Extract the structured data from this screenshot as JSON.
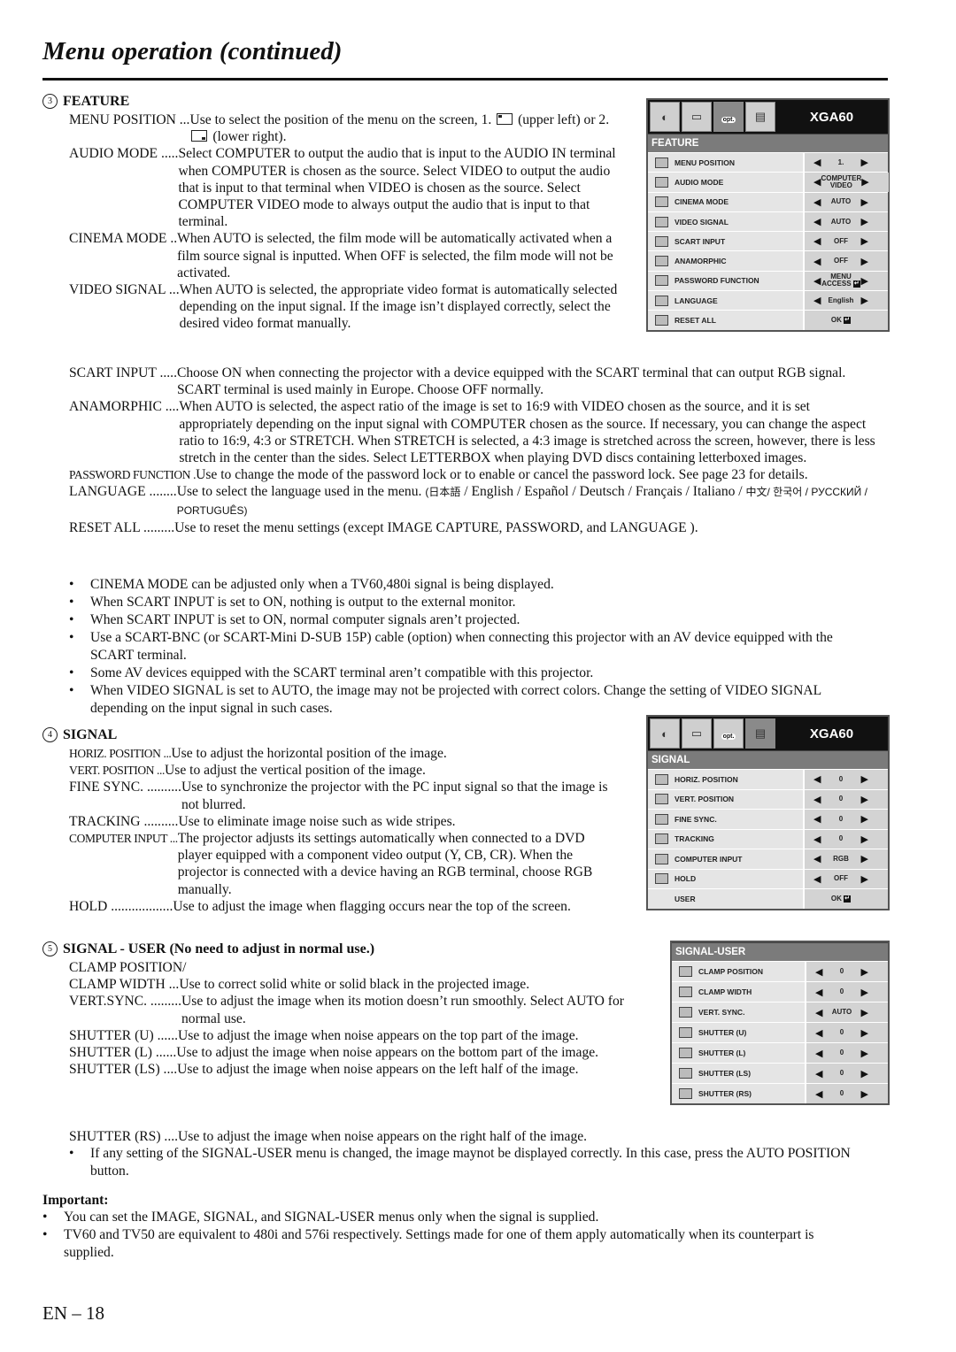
{
  "page": {
    "title": "Menu operation (continued)",
    "page_number": "EN – 18"
  },
  "feature": {
    "number": "3",
    "heading": "FEATURE",
    "items": [
      {
        "term": "MENU POSITION ... ",
        "desc_a": "Use to select the position of the menu on the screen,  1. ",
        "desc_b": " (upper left) or 2. ",
        "desc_c": " (lower right)."
      },
      {
        "term": "AUDIO MODE ..... ",
        "desc": "Select COMPUTER to output the audio that is input to the AUDIO IN terminal when COMPUTER is chosen as the source. Select VIDEO to output the audio that is input to that terminal when VIDEO is chosen as the source. Select COMPUTER VIDEO mode to always output the audio that is input to that terminal."
      },
      {
        "term": "CINEMA MODE .. ",
        "desc": "When AUTO is selected, the film mode will be automatically activated when a film source signal is inputted. When OFF is selected, the film mode will not be activated."
      },
      {
        "term": "VIDEO SIGNAL ... ",
        "desc": "When AUTO is selected, the appropriate video format is automatically selected depending on the input signal. If the image isn’t displayed correctly, select the desired video format manually."
      },
      {
        "term": "SCART INPUT ..... ",
        "desc": "Choose ON when connecting the projector with a device equipped with the SCART terminal that can output RGB signal. SCART terminal is used mainly in Europe. Choose OFF normally."
      },
      {
        "term": "ANAMORPHIC .... ",
        "desc": "When AUTO is selected, the aspect ratio of the image is set to 16:9 with VIDEO chosen as the source, and it is set appropriately depending on the input signal with COMPUTER chosen as the source. If necessary, you can change the aspect ratio to 16:9, 4:3 or STRETCH. When STRETCH is selected, a 4:3 image is stretched across the screen, however, there is less stretch in the center than the sides. Select LETTERBOX when playing DVD discs containing letterboxed images."
      },
      {
        "term": "PASSWORD FUNCTION . ",
        "desc": "Use to change the mode of the password lock or to enable or cancel the password lock. See page 23 for details."
      },
      {
        "term": "LANGUAGE ........ ",
        "desc_a": "Use to select the language used in the menu. ",
        "langs_a": "(日本語",
        "desc_b": " / English / Español / Deutsch / Français / Italiano / ",
        "langs_b": "中文/ 한국어 / РУССКИЙ / PORTUGUÊS)"
      },
      {
        "term": "RESET ALL ......... ",
        "desc": "Use to reset the menu settings (except IMAGE CAPTURE, PASSWORD, and LANGUAGE )."
      }
    ],
    "notes": [
      "CINEMA MODE can be adjusted only when a TV60,480i signal is being displayed.",
      "When SCART INPUT is set to ON, nothing is output to the external monitor.",
      "When SCART INPUT is set to ON, normal computer signals aren’t projected.",
      "Use a SCART-BNC (or SCART-Mini D-SUB 15P) cable (option) when connecting this projector with an AV device equipped with the SCART terminal.",
      "Some AV devices equipped with the SCART terminal aren’t compatible with this projector.",
      "When VIDEO SIGNAL is set to AUTO, the image may not be projected with correct colors. Change the setting of VIDEO SIGNAL depending on the input signal in such cases."
    ]
  },
  "signal": {
    "number": "4",
    "heading": "SIGNAL",
    "items": [
      {
        "term": "HORIZ. POSITION ... ",
        "desc": "Use to adjust the horizontal position of the image."
      },
      {
        "term": "VERT. POSITION ... ",
        "desc": "Use to adjust the vertical position of the image."
      },
      {
        "term": "FINE SYNC. .......... ",
        "desc": "Use to synchronize the projector with the PC input signal so that the image is not blurred."
      },
      {
        "term": "TRACKING .......... ",
        "desc": "Use to eliminate image noise such as wide stripes."
      },
      {
        "term": "COMPUTER INPUT ... ",
        "desc": "The projector adjusts its settings automatically when connected to a DVD player equipped with a component video output (Y, CB, CR). When the projector is connected with a device having an RGB terminal, choose RGB manually."
      },
      {
        "term": "HOLD .................. ",
        "desc": "Use to adjust the image when flagging occurs near the top of the screen."
      }
    ]
  },
  "signal_user": {
    "number": "5",
    "heading": "SIGNAL - USER (No need to adjust in normal use.)",
    "items": [
      {
        "term": "CLAMP POSITION/",
        "desc": ""
      },
      {
        "term": "CLAMP WIDTH ... ",
        "desc": "Use to correct solid white or solid black in the projected image."
      },
      {
        "term": "VERT.SYNC. ......... ",
        "desc": "Use to adjust the image when its motion doesn’t run smoothly. Select AUTO for normal use."
      },
      {
        "term": "SHUTTER (U) ...... ",
        "desc": "Use to adjust the image when noise appears on the top part of the image."
      },
      {
        "term": "SHUTTER (L) ...... ",
        "desc": "Use to adjust the image when noise appears on the bottom part of the image."
      },
      {
        "term": "SHUTTER (LS) .... ",
        "desc": "Use to adjust the image when noise appears on the left half of the image."
      },
      {
        "term": "SHUTTER (RS) .... ",
        "desc": "Use to adjust the image when noise appears on the right half of the image."
      }
    ],
    "notes": [
      "If any setting of the SIGNAL-USER menu is changed, the image maynot be displayed correctly. In this case, press the AUTO POSITION button."
    ]
  },
  "important": {
    "heading": "Important:",
    "notes": [
      "You can set the IMAGE, SIGNAL, and SIGNAL-USER menus only when the signal is supplied.",
      "TV60 and TV50 are equivalent to 480i and 576i respectively. Settings made for one of them apply automatically when its counterpart is supplied."
    ]
  },
  "osd_common": {
    "model": "XGA60",
    "opt_label": "opt.",
    "tabs": [
      "image-adjust-tab",
      "installation-tab",
      "feature-opt-tab",
      "signal-tab"
    ]
  },
  "osd_feature": {
    "header": "FEATURE",
    "rows": [
      {
        "label": "MENU POSITION",
        "value": "1.",
        "icon": "menu-position-icon",
        "arrows": true
      },
      {
        "label": "AUDIO MODE",
        "value": "COMPUTER VIDEO",
        "icon": "audio-mode-icon",
        "arrows": true
      },
      {
        "label": "CINEMA MODE",
        "value": "AUTO",
        "icon": "cinema-mode-icon",
        "arrows": true
      },
      {
        "label": "VIDEO SIGNAL",
        "value": "AUTO",
        "icon": "video-signal-icon",
        "arrows": true
      },
      {
        "label": "SCART INPUT",
        "value": "OFF",
        "icon": "scart-input-icon",
        "arrows": true
      },
      {
        "label": "ANAMORPHIC",
        "value": "OFF",
        "icon": "anamorphic-icon",
        "arrows": true
      },
      {
        "label": "PASSWORD FUNCTION",
        "value": "MENU ACCESS",
        "icon": "password-lock-icon",
        "arrows": true,
        "enter": true
      },
      {
        "label": "LANGUAGE",
        "value": "English",
        "icon": "language-icon",
        "arrows": true
      },
      {
        "label": "RESET ALL",
        "value": "OK",
        "icon": "reset-all-icon",
        "arrows": false,
        "enter": true
      }
    ]
  },
  "osd_signal": {
    "header": "SIGNAL",
    "rows": [
      {
        "label": "HORIZ. POSITION",
        "value": "0",
        "icon": "horiz-position-icon",
        "arrows": true
      },
      {
        "label": "VERT. POSITION",
        "value": "0",
        "icon": "vert-position-icon",
        "arrows": true
      },
      {
        "label": "FINE SYNC.",
        "value": "0",
        "icon": "fine-sync-icon",
        "arrows": true
      },
      {
        "label": "TRACKING",
        "value": "0",
        "icon": "tracking-icon",
        "arrows": true
      },
      {
        "label": "COMPUTER INPUT",
        "value": "RGB",
        "icon": "computer-input-icon",
        "arrows": true
      },
      {
        "label": "HOLD",
        "value": "OFF",
        "icon": "hold-icon",
        "arrows": true
      },
      {
        "label": "USER",
        "value": "OK",
        "icon": "",
        "arrows": false,
        "enter": true
      }
    ]
  },
  "osd_signal_user": {
    "header": "SIGNAL-USER",
    "rows": [
      {
        "label": "CLAMP POSITION",
        "value": "0",
        "icon": "clamp-position-icon",
        "arrows": true
      },
      {
        "label": "CLAMP WIDTH",
        "value": "0",
        "icon": "clamp-width-icon",
        "arrows": true
      },
      {
        "label": "VERT. SYNC.",
        "value": "AUTO",
        "icon": "vert-sync-icon",
        "arrows": true
      },
      {
        "label": "SHUTTER (U)",
        "value": "0",
        "icon": "shutter-upper-icon",
        "arrows": true
      },
      {
        "label": "SHUTTER (L)",
        "value": "0",
        "icon": "shutter-lower-icon",
        "arrows": true
      },
      {
        "label": "SHUTTER (LS)",
        "value": "0",
        "icon": "shutter-left-icon",
        "arrows": true
      },
      {
        "label": "SHUTTER (RS)",
        "value": "0",
        "icon": "shutter-right-icon",
        "arrows": true
      }
    ]
  }
}
